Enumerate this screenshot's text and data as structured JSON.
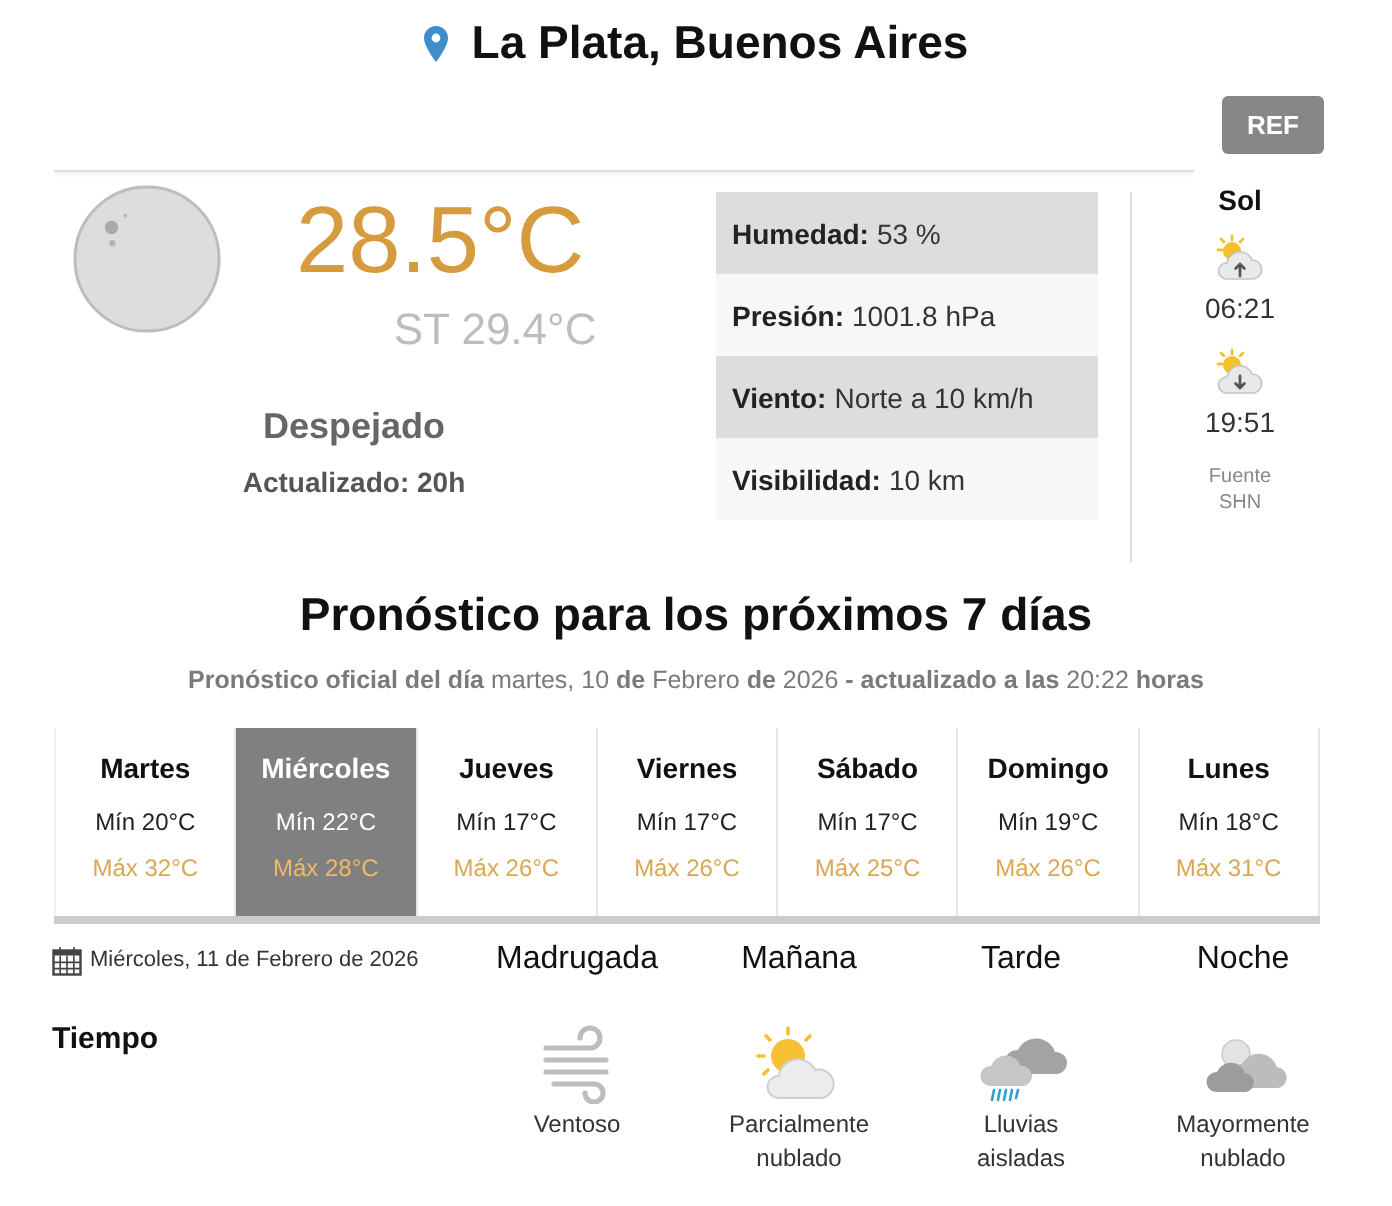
{
  "header": {
    "location": "La Plata, Buenos Aires",
    "ref_button": "REF"
  },
  "current": {
    "temperature": "28.5°C",
    "feels_like": "ST 29.4°C",
    "condition": "Despejado",
    "updated": "Actualizado: 20h",
    "details": [
      {
        "label": "Humedad:",
        "value": "53 %"
      },
      {
        "label": "Presión:",
        "value": "1001.8 hPa"
      },
      {
        "label": "Viento:",
        "value": "Norte a 10 km/h"
      },
      {
        "label": "Visibilidad:",
        "value": "10 km"
      }
    ],
    "sun": {
      "title": "Sol",
      "sunrise": "06:21",
      "sunset": "19:51",
      "source_label": "Fuente",
      "source": "SHN"
    }
  },
  "forecast": {
    "title": "Pronóstico para los próximos 7 días",
    "subtitle": "**Pronóstico oficial del día** martes, 10 **de** Febrero **de** 2026 **- actualizado a las** 20:22 **horas**",
    "days": [
      {
        "name": "Martes",
        "min": "Mín 20°C",
        "max": "Máx 32°C",
        "selected": false
      },
      {
        "name": "Miércoles",
        "min": "Mín 22°C",
        "max": "Máx 28°C",
        "selected": true
      },
      {
        "name": "Jueves",
        "min": "Mín 17°C",
        "max": "Máx 26°C",
        "selected": false
      },
      {
        "name": "Viernes",
        "min": "Mín 17°C",
        "max": "Máx 26°C",
        "selected": false
      },
      {
        "name": "Sábado",
        "min": "Mín 17°C",
        "max": "Máx 25°C",
        "selected": false
      },
      {
        "name": "Domingo",
        "min": "Mín 19°C",
        "max": "Máx 26°C",
        "selected": false
      },
      {
        "name": "Lunes",
        "min": "Mín 18°C",
        "max": "Máx 31°C",
        "selected": false
      }
    ]
  },
  "day_detail": {
    "date": "Miércoles, 11 de Febrero de 2026",
    "row_label": "Tiempo",
    "periods": [
      {
        "name": "Madrugada",
        "kind": "windy",
        "condition": "Ventoso"
      },
      {
        "name": "Mañana",
        "kind": "partly",
        "condition": "Parcialmente nublado"
      },
      {
        "name": "Tarde",
        "kind": "showers",
        "condition": "Lluvias aisladas"
      },
      {
        "name": "Noche",
        "kind": "cloudy",
        "condition": "Mayormente nublado"
      }
    ]
  }
}
